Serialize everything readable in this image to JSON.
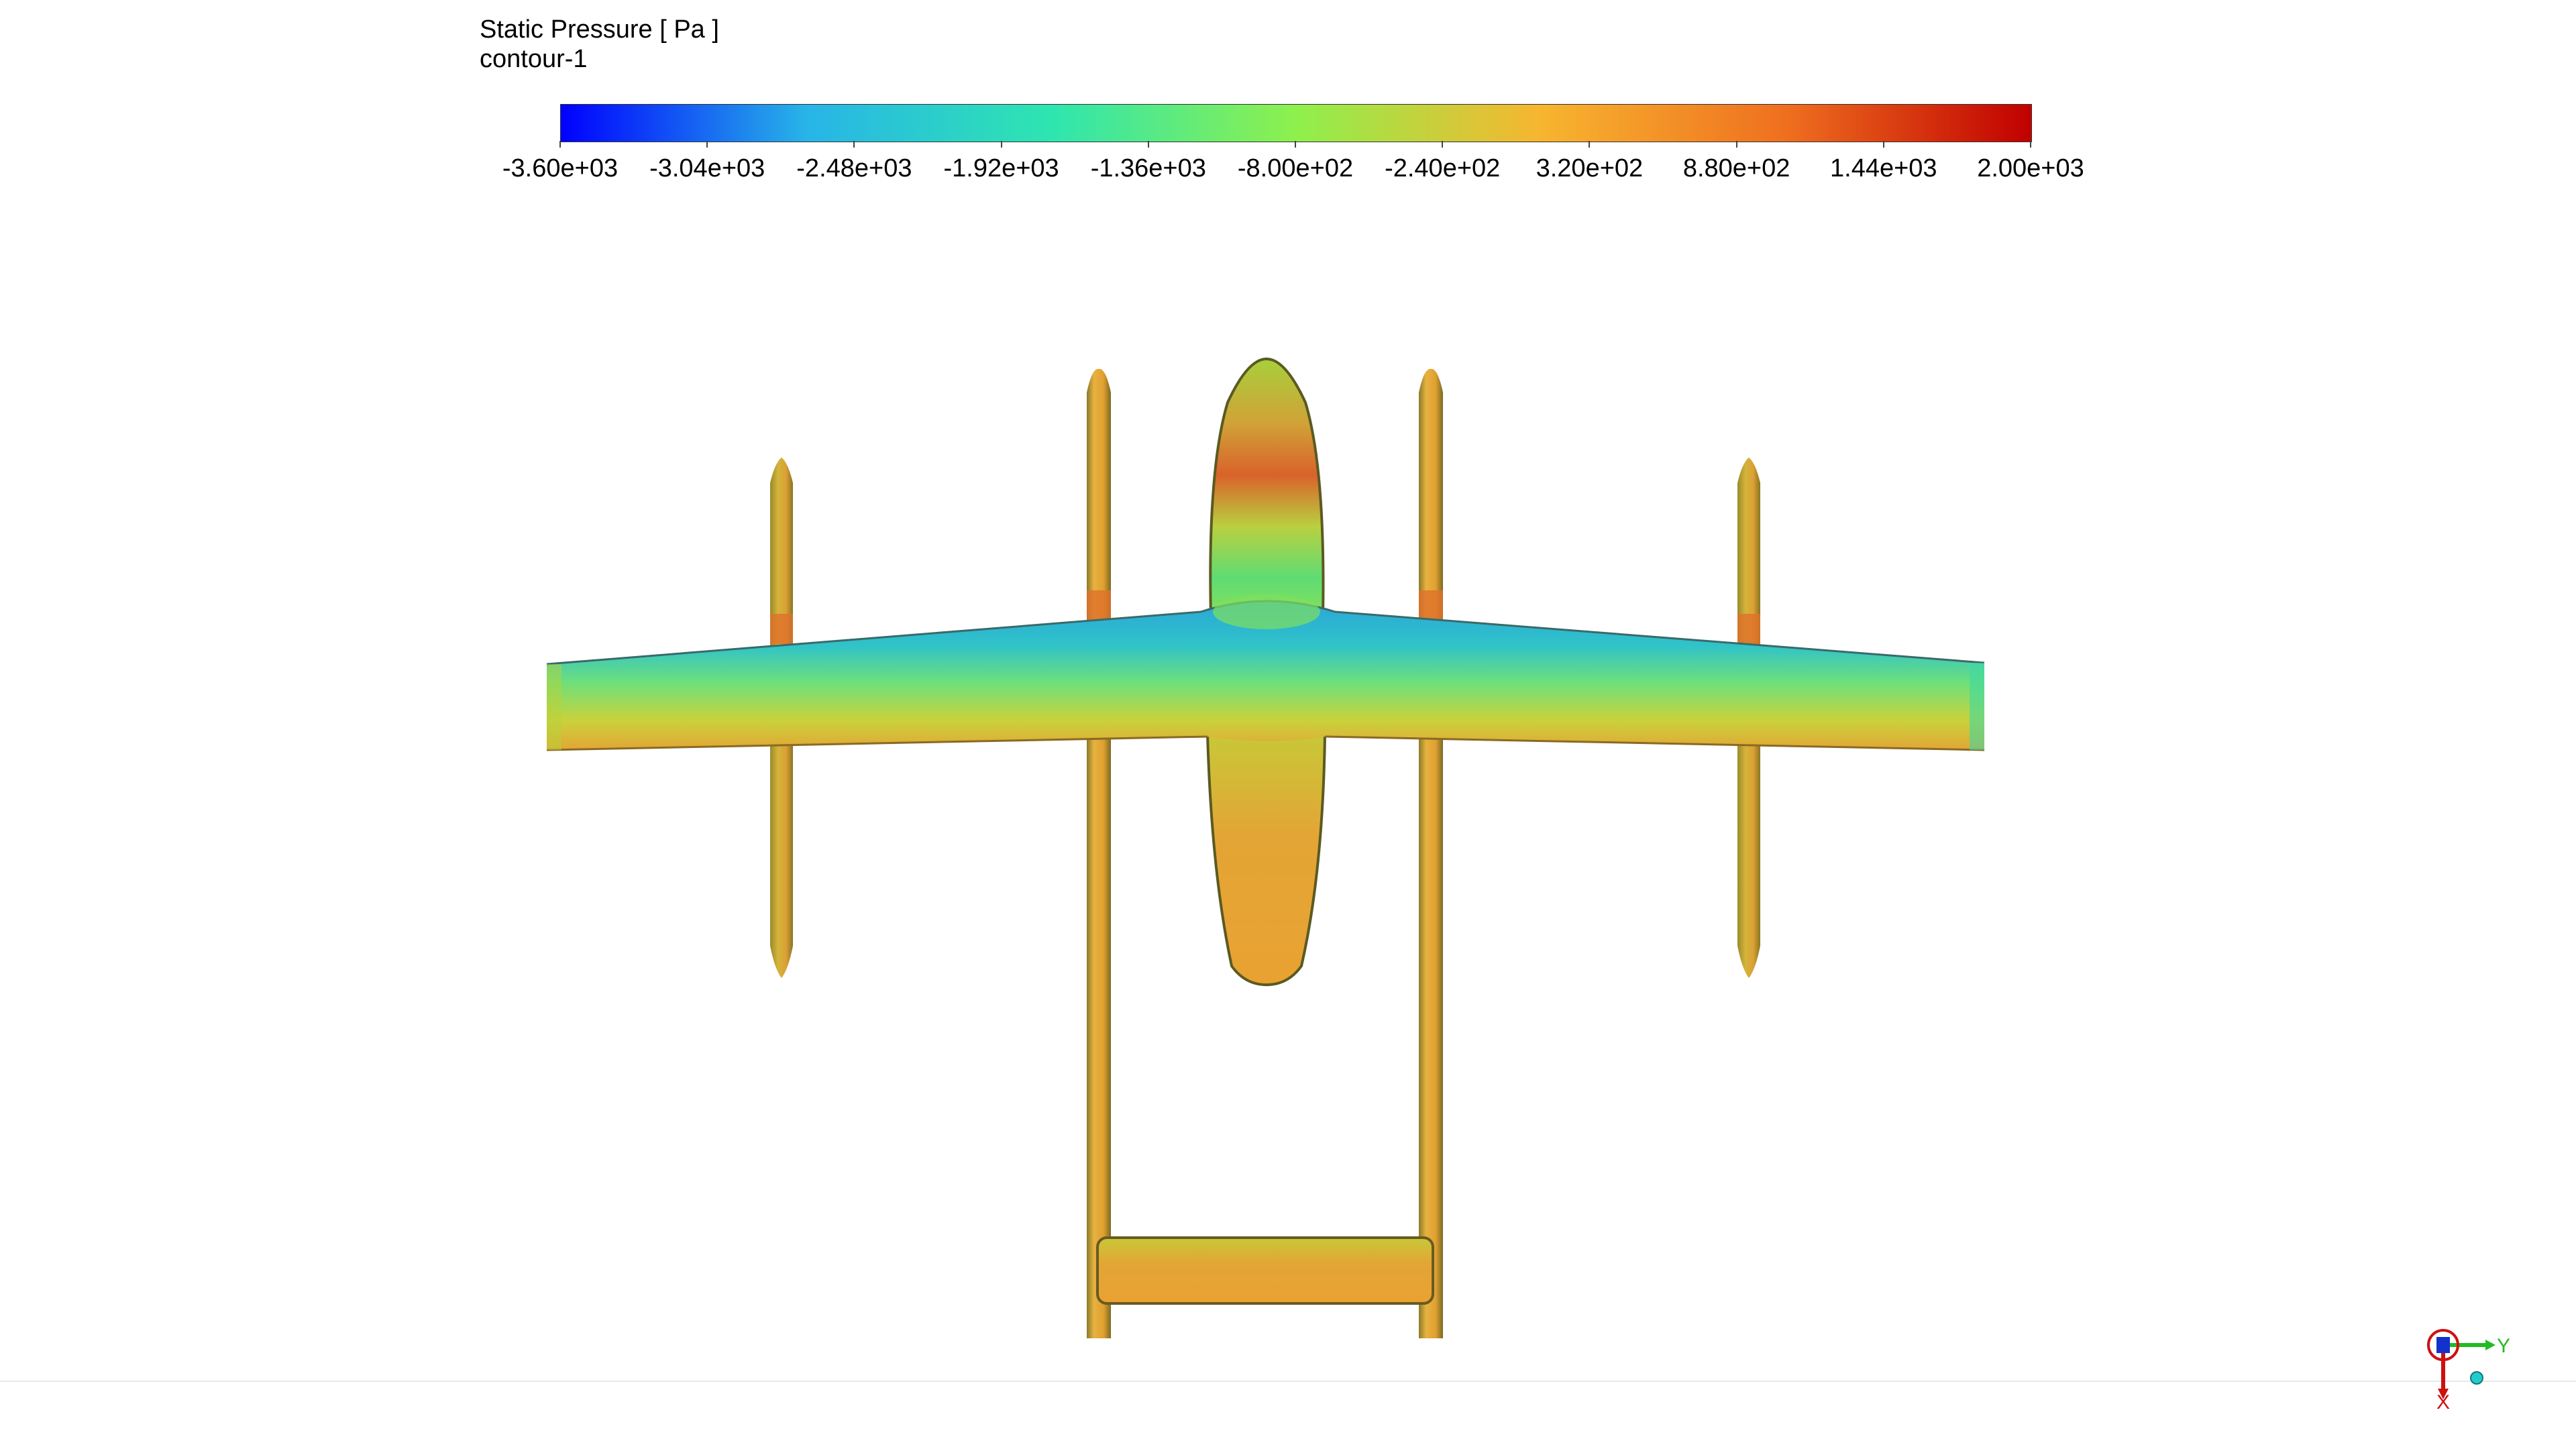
{
  "legend": {
    "title": "Static Pressure [ Pa ]",
    "subtitle": "contour-1",
    "ticks": [
      "-3.60e+03",
      "-3.04e+03",
      "-2.48e+03",
      "-1.92e+03",
      "-1.36e+03",
      "-8.00e+02",
      "-2.40e+02",
      "3.20e+02",
      "8.80e+02",
      "1.44e+03",
      "2.00e+03"
    ],
    "min": -3600,
    "max": 2000,
    "colors": [
      "#0000ff",
      "#28b4e8",
      "#2ee5b0",
      "#8ef04c",
      "#f7b52f",
      "#ef6f1f",
      "#c00000"
    ]
  },
  "axis_triad": {
    "labels": [
      "Y",
      "X"
    ],
    "colors": {
      "x": "#cc1111",
      "y": "#22bb22",
      "z": "#1133cc",
      "origin": "#22cccc"
    }
  },
  "model": {
    "name": "aircraft-surface",
    "colors": {
      "surface": "#e0a030",
      "edge": "#4a4a20",
      "wing_front": "#2aa6d8",
      "wing_mid": "#55dd88",
      "wing_rear": "#c8c838",
      "nose_band": "#d9622a"
    }
  }
}
